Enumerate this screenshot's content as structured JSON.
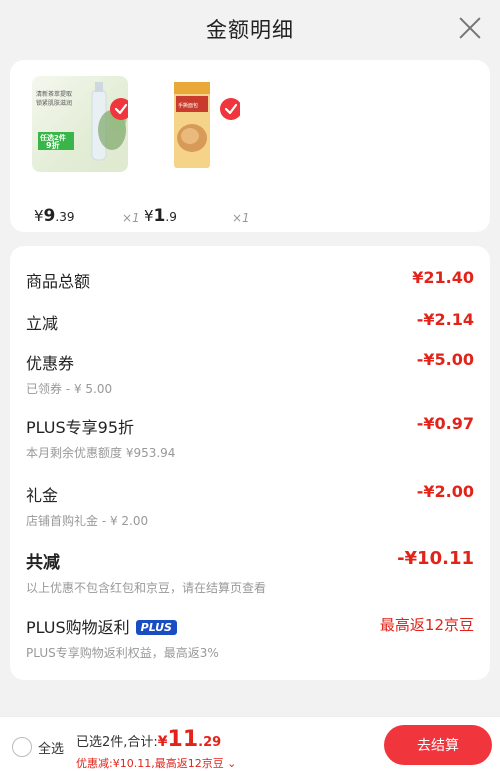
{
  "header": {
    "title": "金额明细"
  },
  "products": [
    {
      "price_symbol": "¥",
      "price_int": "9",
      "price_dec": ".39",
      "qty": "×1",
      "image_text": [
        "清新茶萃提取",
        "锁紧肌肤滋润",
        "任选2件",
        "9折"
      ]
    },
    {
      "price_symbol": "¥",
      "price_int": "1",
      "price_dec": ".9",
      "qty": "×1",
      "image_text": [
        "手撕面包"
      ]
    }
  ],
  "details": {
    "goods_total_label": "商品总额",
    "goods_total_value": "¥21.40",
    "instant_discount_label": "立减",
    "instant_discount_value": "-¥2.14",
    "coupon_label": "优惠券",
    "coupon_sub": "已领券 - ¥ 5.00",
    "coupon_value": "-¥5.00",
    "plus_label": "PLUS专享95折",
    "plus_sub": "本月剩余优惠额度 ¥953.94",
    "plus_value": "-¥0.97",
    "gift_label": "礼金",
    "gift_sub": "店铺首购礼金 - ¥ 2.00",
    "gift_value": "-¥2.00",
    "total_discount_label": "共减",
    "total_discount_value": "-¥10.11",
    "total_discount_note": "以上优惠不包含红包和京豆，请在结算页查看",
    "plus_rebate_label": "PLUS购物返利",
    "plus_badge": "PLUS",
    "plus_rebate_value": "最高返12京豆",
    "plus_rebate_sub": "PLUS专享购物返利权益，最高返3%"
  },
  "bottom": {
    "select_all": "全选",
    "selected_summary": "已选2件,合计:",
    "total_cur": "¥",
    "total_int": "11",
    "total_dec": ".29",
    "discount_line": "优惠减:¥10.11,最高返12京豆 ⌄",
    "checkout": "去结算"
  },
  "colors": {
    "accent": "#e2231a",
    "button": "#f0353d",
    "plus_badge": "#1a4dc2"
  }
}
